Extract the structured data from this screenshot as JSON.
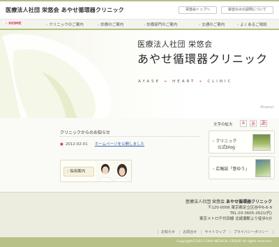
{
  "header": {
    "logo": "医療法人社団 栄悠会 あやせ循環器クリニック",
    "top_button": "栄悠会トップへ",
    "nav_button": "録音のみの説明について"
  },
  "nav": {
    "items": [
      {
        "label": "HOME"
      },
      {
        "label": "クリニックのご案内"
      },
      {
        "label": "診療のご案内"
      },
      {
        "label": "診療部門のご案内"
      },
      {
        "label": "交通のご案内"
      },
      {
        "label": "よくあるご相談"
      }
    ]
  },
  "hero": {
    "org": "医療法人社団 栄悠会",
    "clinic": "あやせ循環器クリニック",
    "tagline_1": "AYASE",
    "tagline_2": "HEART",
    "tagline_3": "CLINIC",
    "plus": "+",
    "repeat": "Repeat"
  },
  "news": {
    "title": "クリニックからのお知らせ",
    "items": [
      {
        "date": "2012-02-01",
        "text": "ホームページを公開しました"
      }
    ]
  },
  "recruit": {
    "label": "採用案内"
  },
  "sidebar": {
    "font_size_label": "文字の拡大",
    "font_small": "あ",
    "font_medium": "あ",
    "font_large": "あ",
    "blog_line1": "クリニック",
    "blog_line2": "公式blog",
    "pr_label": "広報誌「悠ゆう」"
  },
  "footer": {
    "org": "医療法人社団 栄悠会",
    "clinic": "あやせ循環器クリニック",
    "postal": "〒120-0006 東京都足立区谷中6-6-9",
    "tel": "TEL.03-3605-2621(代)",
    "access": "東京メトロ千代田線 北綾瀬駅より徒歩5分",
    "links": [
      "お知らせ",
      "お問合せ",
      "サイトマップ",
      "プライバシーポリシー"
    ],
    "copyright": "Copyright(C)2012 EIKAI MEDICAL GROUP. All rights reserved."
  },
  "colors": {
    "accent_pink": "#d9445c",
    "olive": "#b5c07d",
    "footer_bg": "#ecedde"
  }
}
